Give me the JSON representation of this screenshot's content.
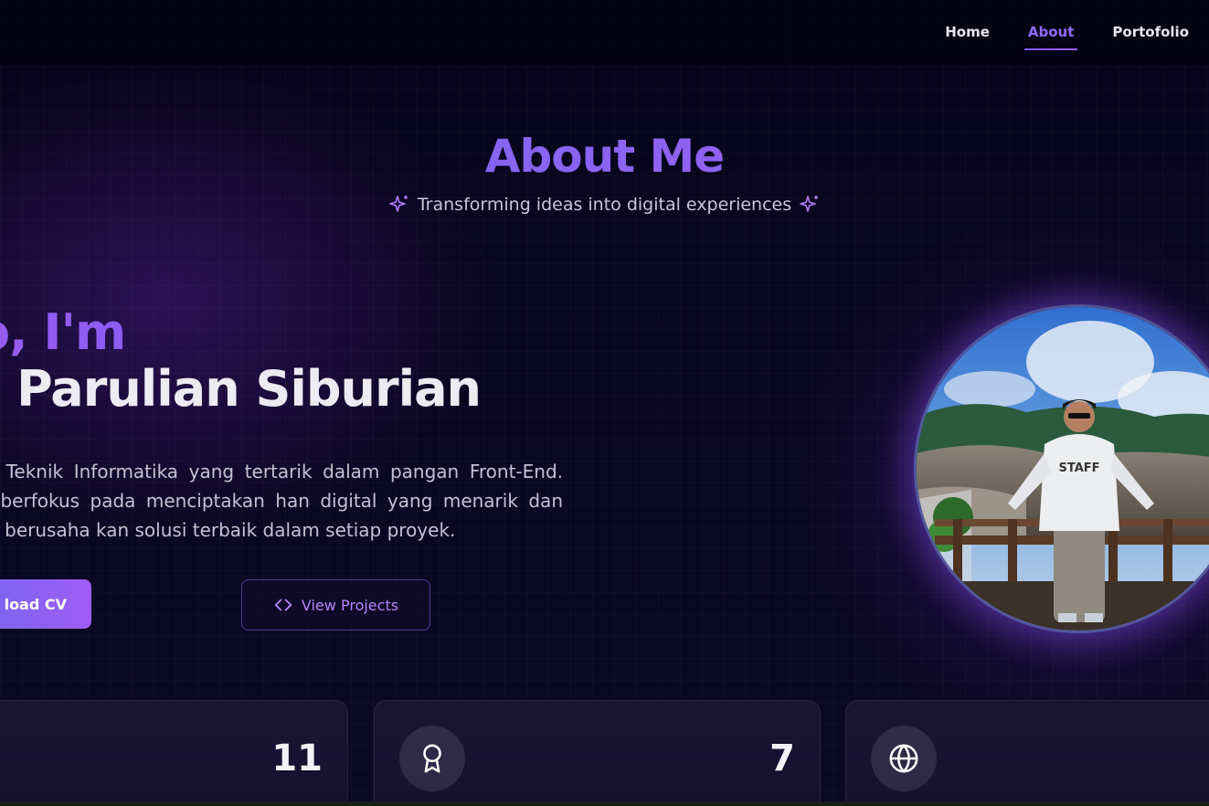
{
  "nav": {
    "items": [
      {
        "label": "Home"
      },
      {
        "label": "About"
      },
      {
        "label": "Portofolio"
      }
    ],
    "active": "About"
  },
  "header": {
    "title": "About Me",
    "subtitle": "Transforming ideas into digital experiences"
  },
  "hero": {
    "greeting": "o, I'm",
    "name": "han Parulian Siburian",
    "bio": "siswa Teknik Informatika yang tertarik dalam pangan Front-End. Saya berfokus pada menciptakan han digital yang menarik dan selalu berusaha kan solusi terbaik dalam setiap proyek."
  },
  "buttons": {
    "download_label": "load CV",
    "projects_label": "View Projects"
  },
  "stats": [
    {
      "icon": "code-icon",
      "value": "11"
    },
    {
      "icon": "award-icon",
      "value": "7"
    },
    {
      "icon": "globe-icon",
      "value": ""
    }
  ],
  "colors": {
    "accent": "#8f6cff",
    "gradient_start": "#6c6bf0",
    "gradient_end": "#a05cf5",
    "background": "#070416"
  }
}
